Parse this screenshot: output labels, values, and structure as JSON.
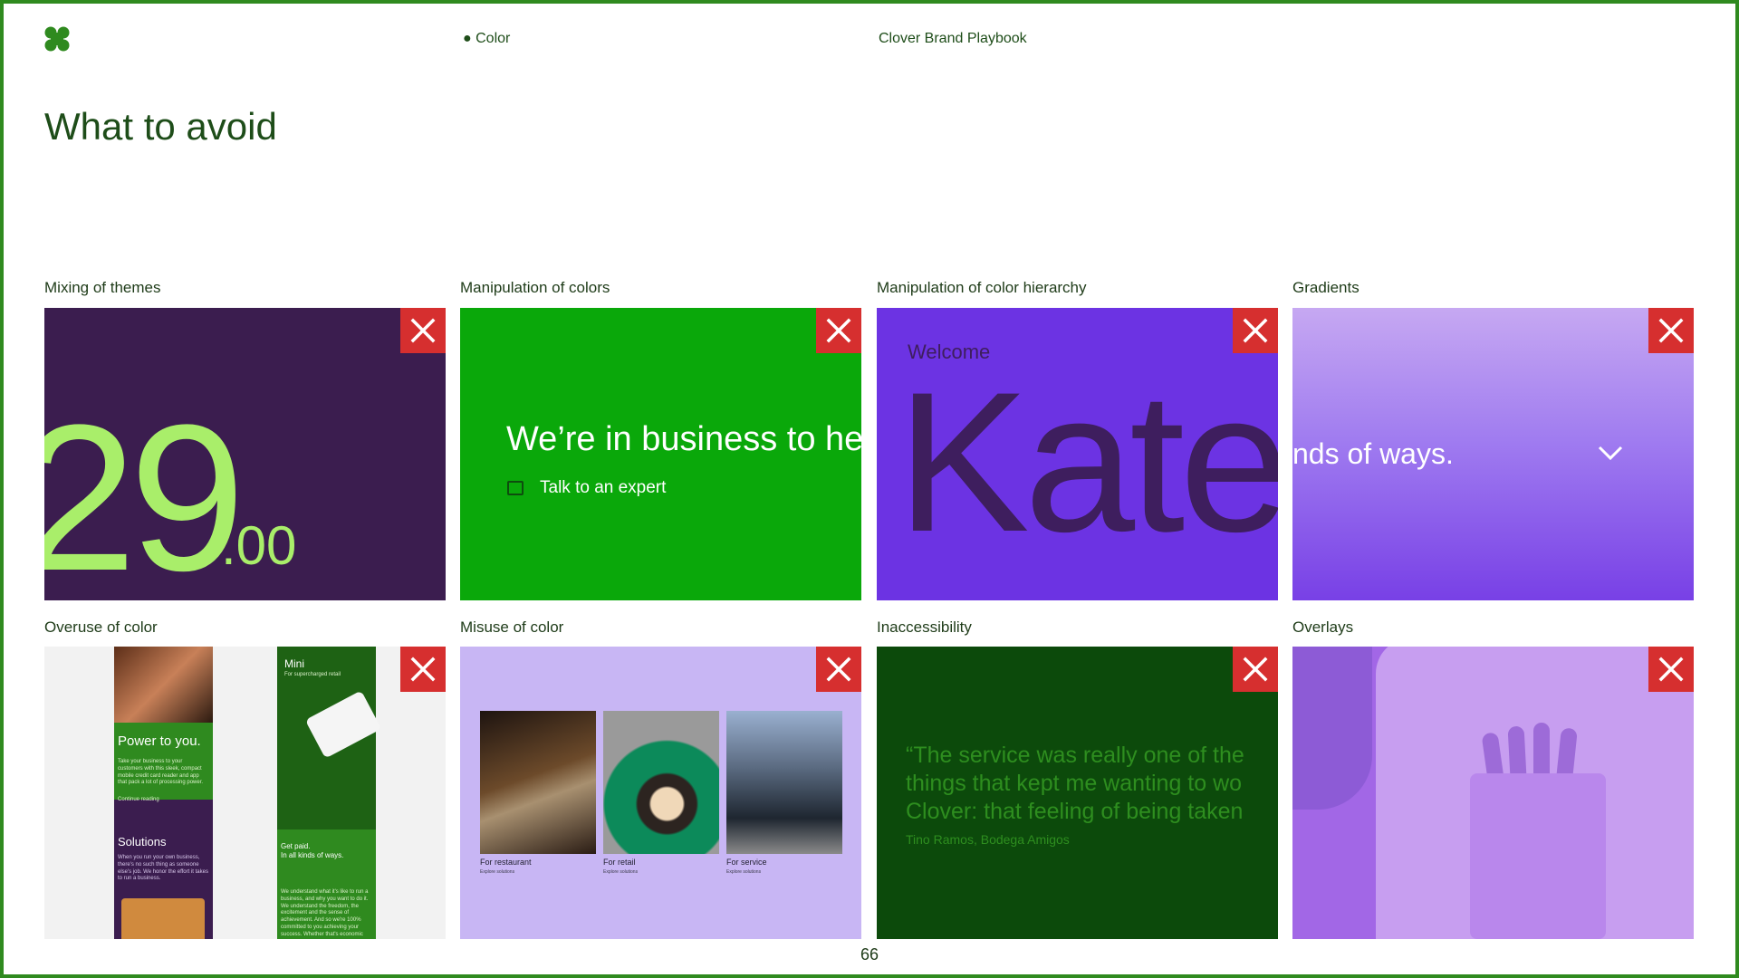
{
  "header": {
    "section": "● Color",
    "document_title": "Clover Brand Playbook",
    "logo_icon": "clover-logo-icon"
  },
  "page": {
    "title": "What to avoid",
    "number": "66"
  },
  "colors": {
    "frame_border": "#2f8a1f",
    "badge_red": "#d62f2f",
    "clover_green": "#2f8a1f",
    "dark_purple": "#3b1d4f",
    "bright_green": "#0aa80a",
    "violet": "#6c33e3",
    "lavender": "#c8b6f4",
    "forest": "#0c4a0b"
  },
  "examples": [
    {
      "label": "Mixing of themes",
      "badge_icon": "x-icon",
      "content": {
        "big": "29",
        "small": ".00"
      }
    },
    {
      "label": "Manipulation of colors",
      "badge_icon": "x-icon",
      "content": {
        "headline": "We’re in business to he",
        "cta": "Talk to an expert"
      }
    },
    {
      "label": "Manipulation of color hierarchy",
      "badge_icon": "x-icon",
      "content": {
        "greeting": "Welcome",
        "name": "Kate"
      }
    },
    {
      "label": "Gradients",
      "badge_icon": "x-icon",
      "content": {
        "text": "nds of ways."
      }
    },
    {
      "label": "Overuse of color",
      "badge_icon": "x-icon",
      "content": {
        "left_heading": "Power to you.",
        "left_body": "Take your business to your customers with this sleek, compact mobile credit card reader and app that pack a lot of processing power.",
        "left_link": "Continue reading",
        "left_heading2": "Solutions",
        "left_body2": "When you run your own business, there's no such thing as someone else's job. We honor the effort it takes to run a business.",
        "right_heading": "Mini",
        "right_sub": "For supercharged retail",
        "right_heading2": "Get paid.\nIn all kinds of ways.",
        "right_body": "We understand what it's like to run a business, and why you want to do it. We understand the freedom, the excitement and the sense of achievement. And so we're 100% committed to you achieving your success. Whether that's economic"
      }
    },
    {
      "label": "Misuse of color",
      "badge_icon": "x-icon",
      "content": {
        "captions": [
          "For restaurant",
          "For retail",
          "For service"
        ],
        "links": [
          "Explore solutions",
          "Explore solutions",
          "Explore solutions"
        ]
      }
    },
    {
      "label": "Inaccessibility",
      "badge_icon": "x-icon",
      "content": {
        "quote_lines": [
          "“The service was really one of the",
          "things that kept me wanting to wo",
          "Clover: that feeling of being taken"
        ],
        "author": "Tino Ramos, Bodega Amigos"
      }
    },
    {
      "label": "Overlays",
      "badge_icon": "x-icon",
      "content": {}
    }
  ]
}
